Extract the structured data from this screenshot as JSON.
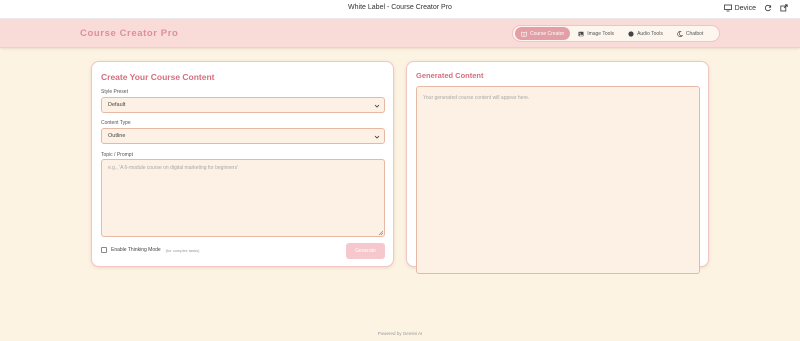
{
  "window": {
    "title": "White Label - Course Creator Pro",
    "device_label": "Device"
  },
  "header": {
    "brand": "Course Creator Pro",
    "nav": [
      {
        "label": "Course Creator",
        "icon": "book-icon",
        "active": true
      },
      {
        "label": "Image Tools",
        "icon": "image-icon",
        "active": false
      },
      {
        "label": "Audio Tools",
        "icon": "audio-icon",
        "active": false
      },
      {
        "label": "Chatbot",
        "icon": "moon-icon",
        "active": false
      }
    ]
  },
  "create_panel": {
    "title": "Create Your Course Content",
    "style_preset": {
      "label": "Style Preset",
      "value": "Default"
    },
    "content_type": {
      "label": "Content Type",
      "value": "Outline"
    },
    "topic": {
      "label": "Topic / Prompt",
      "placeholder": "e.g., 'A 6-module course on digital marketing for beginners'"
    },
    "thinking_mode": {
      "label": "Enable Thinking Mode",
      "hint": "(for complex tasks)",
      "checked": false
    },
    "generate_label": "Generate"
  },
  "output_panel": {
    "title": "Generated Content",
    "placeholder": "Your generated course content will appear here."
  },
  "footer": {
    "text": "Powered by Gemini AI"
  },
  "colors": {
    "accent": "#d56f80",
    "header_bg": "#f9dcd7",
    "page_bg": "#fcf3e2",
    "active_tab": "#e29fa6"
  }
}
